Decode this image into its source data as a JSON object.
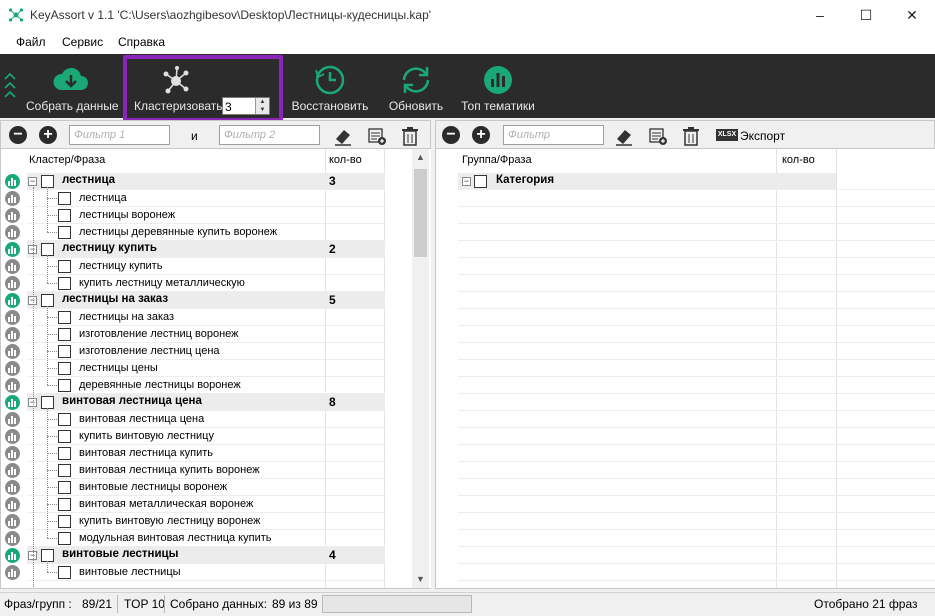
{
  "window": {
    "title": "KeyAssort v 1.1  'C:\\Users\\aozhgibesov\\Desktop\\Лестницы-кудесницы.kap'"
  },
  "menu": [
    "Файл",
    "Сервис",
    "Справка"
  ],
  "toolbar": {
    "collect": "Собрать данные",
    "cluster": "Кластеризовать",
    "cluster_value": "3",
    "restore": "Восстановить",
    "update": "Обновить",
    "top": "Топ тематики"
  },
  "left_toolbar": {
    "filter1_placeholder": "Фильтр 1",
    "and": "и",
    "filter2_placeholder": "Фильтр 2"
  },
  "right_toolbar": {
    "filter_placeholder": "Фильтр",
    "export": "Экспорт",
    "xlsx_badge": "XLSX"
  },
  "left_table": {
    "headers": [
      "Кластер/Фраза",
      "кол-во"
    ],
    "rows": [
      {
        "type": "group",
        "text": "лестница",
        "count": "3",
        "status": "green"
      },
      {
        "type": "item",
        "text": "лестница"
      },
      {
        "type": "item",
        "text": "лестницы воронеж"
      },
      {
        "type": "item",
        "text": "лестницы деревянные купить воронеж"
      },
      {
        "type": "group",
        "text": "лестницу купить",
        "count": "2",
        "status": "green"
      },
      {
        "type": "item",
        "text": "лестницу купить"
      },
      {
        "type": "item",
        "text": "купить лестницу металлическую"
      },
      {
        "type": "group",
        "text": "лестницы на заказ",
        "count": "5",
        "status": "green"
      },
      {
        "type": "item",
        "text": "лестницы на заказ"
      },
      {
        "type": "item",
        "text": "изготовление лестниц воронеж"
      },
      {
        "type": "item",
        "text": "изготовление лестниц цена"
      },
      {
        "type": "item",
        "text": "лестницы цены"
      },
      {
        "type": "item",
        "text": "деревянные лестницы воронеж"
      },
      {
        "type": "group",
        "text": "винтовая лестница цена",
        "count": "8",
        "status": "green"
      },
      {
        "type": "item",
        "text": "винтовая лестница цена"
      },
      {
        "type": "item",
        "text": "купить винтовую лестницу"
      },
      {
        "type": "item",
        "text": "винтовая лестница купить"
      },
      {
        "type": "item",
        "text": "винтовая лестница купить воронеж"
      },
      {
        "type": "item",
        "text": "винтовые лестницы воронеж"
      },
      {
        "type": "item",
        "text": "винтовая металлическая воронеж"
      },
      {
        "type": "item",
        "text": "купить винтовую лестницу воронеж"
      },
      {
        "type": "item",
        "text": "модульная винтовая лестница купить"
      },
      {
        "type": "group",
        "text": "винтовые лестницы",
        "count": "4",
        "status": "green"
      },
      {
        "type": "item",
        "text": "винтовые лестницы"
      }
    ]
  },
  "right_table": {
    "headers": [
      "Группа/Фраза",
      "кол-во"
    ],
    "rows": [
      {
        "type": "group",
        "text": "Категория"
      }
    ]
  },
  "status": {
    "phrases_label": "Фраз/групп :",
    "phrases_value": "89/21",
    "top": "TOP 10",
    "collected_label": "Собрано данных:",
    "collected_value": "89 из 89",
    "shown": "Отобрано 21 фраз"
  },
  "colors": {
    "highlight": "#8b24b8",
    "toolbar_bg": "#2b2b2b",
    "accent_green": "#1aa877"
  }
}
